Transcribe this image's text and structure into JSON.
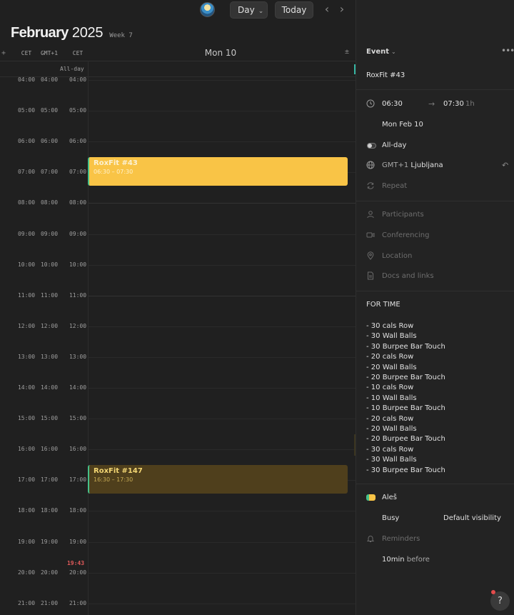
{
  "toolbar": {
    "view_label": "Day",
    "today_label": "Today",
    "prev_icon": "chevron-left-icon",
    "next_icon": "chevron-right-icon"
  },
  "header": {
    "month": "February",
    "year": "2025",
    "week": "Week 7"
  },
  "timezones": {
    "add": "+",
    "labels": [
      "CET",
      "GMT+1",
      "CET"
    ]
  },
  "day": {
    "label": "Mon 10",
    "collapse": "±",
    "allday_label": "All-day"
  },
  "hours": [
    "04:00",
    "05:00",
    "06:00",
    "07:00",
    "08:00",
    "09:00",
    "10:00",
    "11:00",
    "12:00",
    "13:00",
    "14:00",
    "15:00",
    "16:00",
    "17:00",
    "18:00",
    "19:00",
    "20:00",
    "21:00"
  ],
  "now": "19:43",
  "events": [
    {
      "title": "RoxFit #43",
      "time": "06:30 – 07:30"
    },
    {
      "title": "RoxFit #147",
      "time": "16:30 – 17:30"
    }
  ],
  "panel": {
    "type_label": "Event",
    "more": "•••",
    "event_name": "RoxFit #43",
    "start": "06:30",
    "arrow": "→",
    "end": "07:30",
    "duration": "1h",
    "date": "Mon Feb 10",
    "allday": "All-day",
    "timezone_offset": "GMT+1",
    "timezone_city": "Ljubljana",
    "reset": "↶",
    "repeat": "Repeat",
    "participants": "Participants",
    "conferencing": "Conferencing",
    "location": "Location",
    "docs": "Docs and links",
    "description_title": "FOR TIME",
    "description_items": [
      "- 30 cals Row",
      "- 30 Wall Balls",
      "- 30 Burpee Bar Touch",
      "- 20 cals Row",
      "- 20 Wall Balls",
      "- 20 Burpee Bar Touch",
      "- 10 cals Row",
      "- 10 Wall Balls",
      "- 10 Burpee Bar Touch",
      "- 20 cals Row",
      "- 20 Wall Balls",
      "- 20 Burpee Bar Touch",
      "- 30 cals Row",
      "- 30 Wall Balls",
      "- 30 Burpee Bar Touch"
    ],
    "calendar_owner": "Aleš",
    "busy": "Busy",
    "visibility": "Default visibility",
    "reminders": "Reminders",
    "reminder_amount": "10min",
    "reminder_suffix": "before",
    "help": "?"
  },
  "colors": {
    "event_primary": "#f9c446",
    "event_secondary": "#4f3f1c",
    "event_bar": "#45c08a",
    "now_indicator": "#e05a5a"
  }
}
